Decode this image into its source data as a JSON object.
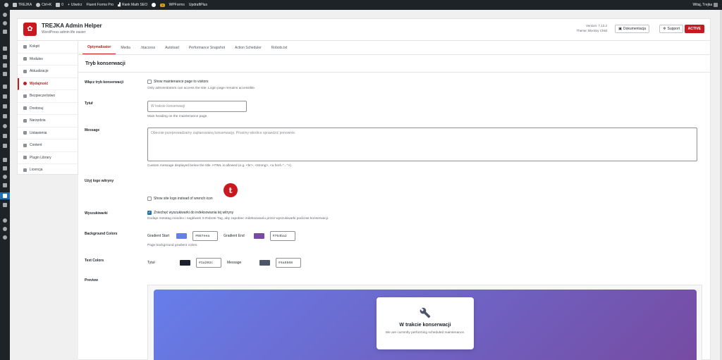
{
  "adminbar": {
    "site_name": "TREJKA",
    "shortcut": "Ctrl+K",
    "comments": "0",
    "new_label": "Utwórz",
    "fluent": "Fluent Forms Pro",
    "rankmath": "Rank Math SEO",
    "notif_count": "3",
    "wpforms": "WPForms",
    "updraft": "UpdraftPlus",
    "greeting": "Witaj, Trejka"
  },
  "header": {
    "title": "TREJKA Admin Helper",
    "subtitle": "WordPress admin life easier",
    "version": "Version: 7.13.2",
    "theme": "Theme: Blocksy Child",
    "docs_label": "Dokumentacja",
    "support_label": "Support",
    "active_label": "ACTIVE"
  },
  "nav": {
    "items": [
      {
        "label": "Kokpit",
        "icon": "dashboard-icon"
      },
      {
        "label": "Modules",
        "icon": "modules-icon"
      },
      {
        "label": "Aktualizacje",
        "icon": "updates-icon"
      },
      {
        "label": "Wydajność",
        "icon": "performance-icon"
      },
      {
        "label": "Bezpieczeństwo",
        "icon": "security-icon"
      },
      {
        "label": "Dostosuj",
        "icon": "customize-icon"
      },
      {
        "label": "Narzędzia",
        "icon": "tools-icon"
      },
      {
        "label": "Ustawienia",
        "icon": "settings-icon"
      },
      {
        "label": "Content",
        "icon": "content-icon"
      },
      {
        "label": "Plugin Library",
        "icon": "plugin-library-icon"
      },
      {
        "label": "Licencja",
        "icon": "license-icon"
      }
    ]
  },
  "tabs": [
    "Optymalizator",
    "Media",
    ".htaccess",
    "Autoload",
    "Performance Snapshot",
    "Action Scheduler",
    "Robots.txt"
  ],
  "section": {
    "title": "Tryb konserwacji"
  },
  "form": {
    "enable": {
      "label": "Włącz tryb konserwacji",
      "checkbox_label": "Show maintenance page to visitors",
      "desc": "Only administrators can access the site. Login page remains accessible."
    },
    "title": {
      "label": "Tytuł",
      "placeholder": "W trakcie konserwacji",
      "desc": "Main heading on the maintenance page."
    },
    "message": {
      "label": "Message",
      "placeholder": "Obecnie przeprowadzamy zaplanowaną konserwację. Prosimy wkrótce sprawdzić ponownie.",
      "desc": "Custom message displayed below the title. HTML is allowed (e.g. <br>, <strong>, <a href=\"...\">)."
    },
    "logo": {
      "label": "Użyj logo witryny",
      "checkbox_label": "Show site logo instead of wrench icon",
      "logo_letter": "t"
    },
    "search": {
      "label": "Wyszukiwarki",
      "checkbox_label": "Zniechęć wyszukiwarki do indeksowania tej witryny",
      "desc": "Dodaje metatag noindex i nagłówek X-Robots-Tag, aby zapobiec indeksowaniu przez wyszukiwarki podczas konserwacji."
    },
    "bg_colors": {
      "label": "Background Colors",
      "start_label": "Gradient Start",
      "start_hex": "#667eea",
      "end_label": "Gradient End",
      "end_hex": "#764ba2",
      "desc": "Page background gradient colors."
    },
    "text_colors": {
      "label": "Text Colors",
      "title_label": "Tytuł",
      "title_hex": "#1a202c",
      "message_label": "Message",
      "message_hex": "#4a5568"
    },
    "preview": {
      "label": "Preview",
      "card_title": "W trakcie konserwacji",
      "card_desc": "We are currently performing scheduled maintenance."
    }
  },
  "colors": {
    "accent": "#c9191f",
    "wp_blue": "#2271b1"
  }
}
